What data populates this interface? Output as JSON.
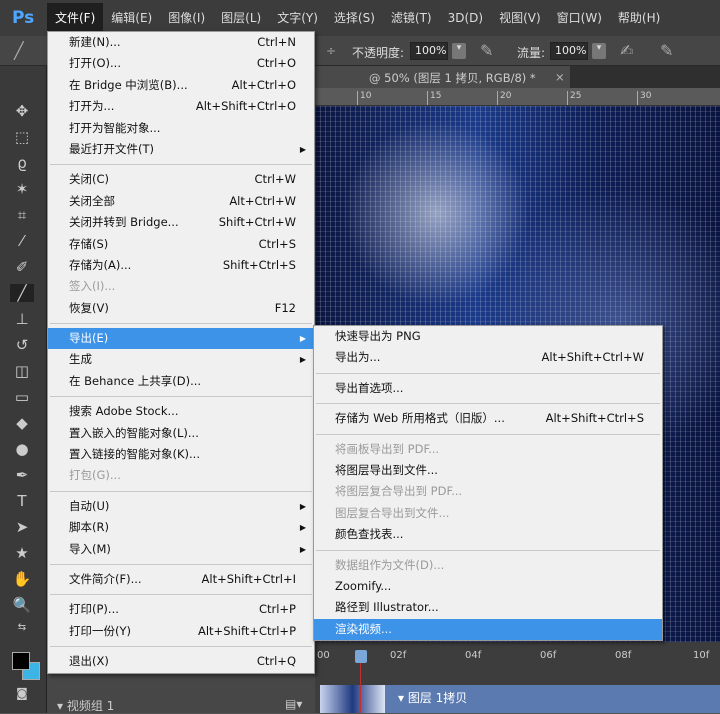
{
  "app": {
    "logo": "Ps"
  },
  "menubar": [
    "文件(F)",
    "编辑(E)",
    "图像(I)",
    "图层(L)",
    "文字(Y)",
    "选择(S)",
    "滤镜(T)",
    "3D(D)",
    "视图(V)",
    "窗口(W)",
    "帮助(H)"
  ],
  "options": {
    "opacity_label": "不透明度:",
    "opacity_value": "100%",
    "flow_label": "流量:",
    "flow_value": "100%"
  },
  "document_tab": {
    "title": "@ 50% (图层 1 拷贝, RGB/8) *",
    "close": "×"
  },
  "ruler": [
    "10",
    "15",
    "20",
    "25",
    "30"
  ],
  "file_menu": [
    {
      "label": "新建(N)...",
      "shortcut": "Ctrl+N"
    },
    {
      "label": "打开(O)...",
      "shortcut": "Ctrl+O"
    },
    {
      "label": "在 Bridge 中浏览(B)...",
      "shortcut": "Alt+Ctrl+O"
    },
    {
      "label": "打开为...",
      "shortcut": "Alt+Shift+Ctrl+O"
    },
    {
      "label": "打开为智能对象..."
    },
    {
      "label": "最近打开文件(T)",
      "submenu": true
    },
    {
      "sep": true
    },
    {
      "label": "关闭(C)",
      "shortcut": "Ctrl+W"
    },
    {
      "label": "关闭全部",
      "shortcut": "Alt+Ctrl+W"
    },
    {
      "label": "关闭并转到 Bridge...",
      "shortcut": "Shift+Ctrl+W"
    },
    {
      "label": "存储(S)",
      "shortcut": "Ctrl+S"
    },
    {
      "label": "存储为(A)...",
      "shortcut": "Shift+Ctrl+S"
    },
    {
      "label": "签入(I)...",
      "disabled": true
    },
    {
      "label": "恢复(V)",
      "shortcut": "F12"
    },
    {
      "sep": true
    },
    {
      "label": "导出(E)",
      "submenu": true,
      "highlighted": true
    },
    {
      "label": "生成",
      "submenu": true
    },
    {
      "label": "在 Behance 上共享(D)..."
    },
    {
      "sep": true
    },
    {
      "label": "搜索 Adobe Stock..."
    },
    {
      "label": "置入嵌入的智能对象(L)..."
    },
    {
      "label": "置入链接的智能对象(K)..."
    },
    {
      "label": "打包(G)...",
      "disabled": true
    },
    {
      "sep": true
    },
    {
      "label": "自动(U)",
      "submenu": true
    },
    {
      "label": "脚本(R)",
      "submenu": true
    },
    {
      "label": "导入(M)",
      "submenu": true
    },
    {
      "sep": true
    },
    {
      "label": "文件简介(F)...",
      "shortcut": "Alt+Shift+Ctrl+I"
    },
    {
      "sep": true
    },
    {
      "label": "打印(P)...",
      "shortcut": "Ctrl+P"
    },
    {
      "label": "打印一份(Y)",
      "shortcut": "Alt+Shift+Ctrl+P"
    },
    {
      "sep": true
    },
    {
      "label": "退出(X)",
      "shortcut": "Ctrl+Q"
    }
  ],
  "export_menu": [
    {
      "label": "快速导出为 PNG"
    },
    {
      "label": "导出为...",
      "shortcut": "Alt+Shift+Ctrl+W"
    },
    {
      "sep": true
    },
    {
      "label": "导出首选项..."
    },
    {
      "sep": true
    },
    {
      "label": "存储为 Web 所用格式（旧版）...",
      "shortcut": "Alt+Shift+Ctrl+S"
    },
    {
      "sep": true
    },
    {
      "label": "将画板导出到 PDF...",
      "disabled": true
    },
    {
      "label": "将图层导出到文件..."
    },
    {
      "label": "将图层复合导出到 PDF...",
      "disabled": true
    },
    {
      "label": "图层复合导出到文件...",
      "disabled": true
    },
    {
      "label": "颜色查找表..."
    },
    {
      "sep": true
    },
    {
      "label": "数据组作为文件(D)...",
      "disabled": true
    },
    {
      "label": "Zoomify..."
    },
    {
      "label": "路径到 Illustrator..."
    },
    {
      "label": "渲染视频...",
      "highlighted": true
    }
  ],
  "timeline": {
    "ticks": [
      "00",
      "02f",
      "04f",
      "06f",
      "08f",
      "10f"
    ],
    "track": "▾ 图层 1拷贝"
  },
  "layers": {
    "group": "▾ 视频组 1"
  },
  "colors": {
    "highlight": "#3c93e8",
    "foreground": "#000000",
    "background": "#3cb4e6"
  }
}
